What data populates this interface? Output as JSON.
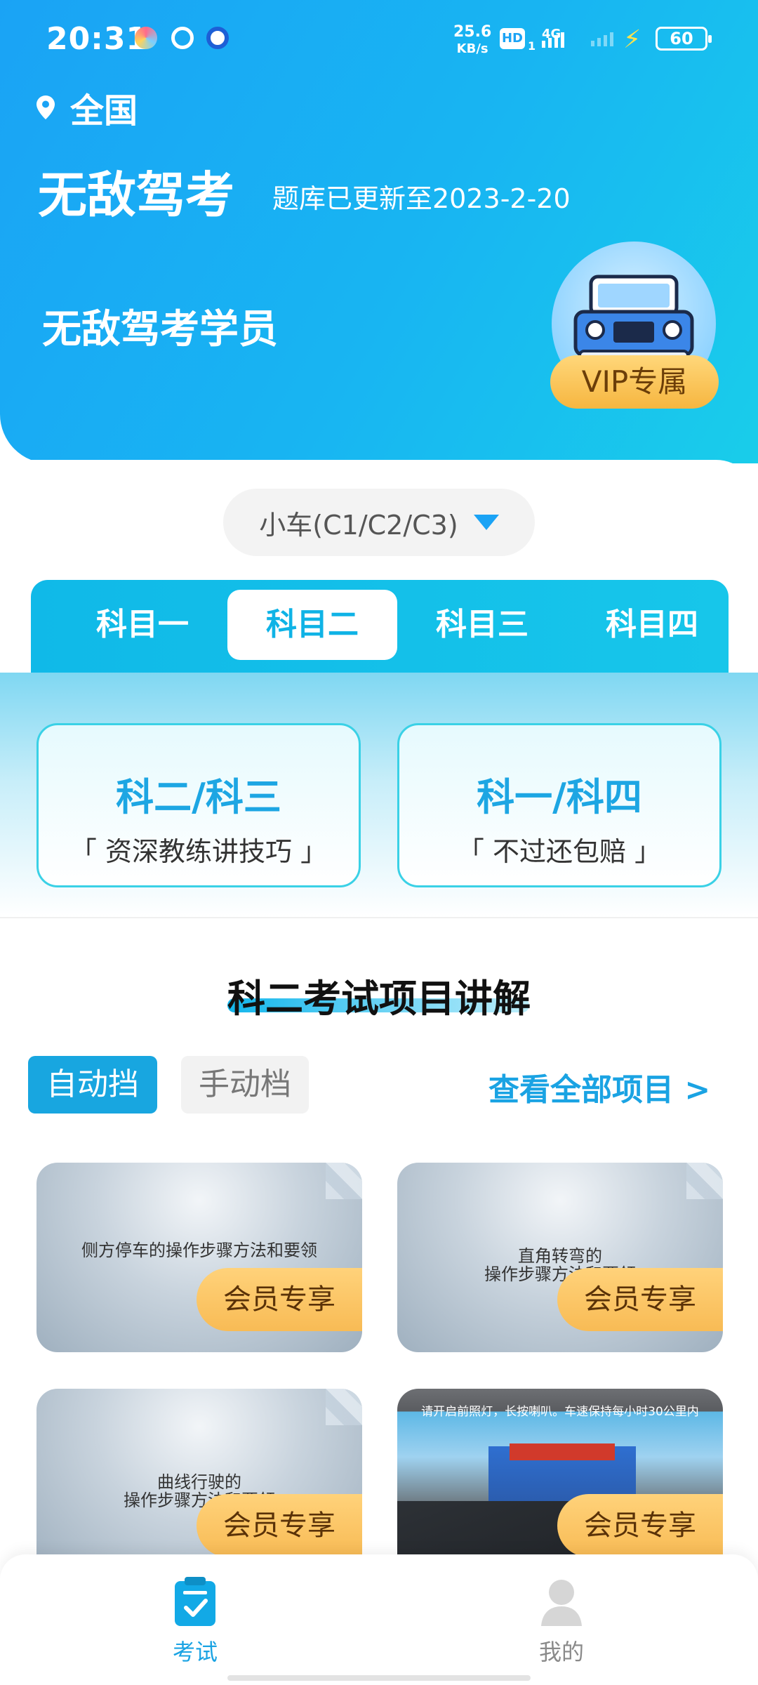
{
  "status_bar": {
    "time": "20:31",
    "net_speed_value": "25.6",
    "net_speed_unit": "KB/s",
    "hd": "HD",
    "hd_sub": "1",
    "network": "4G",
    "battery": "60",
    "icons": [
      "app-notification-icon",
      "app-notification-icon-2",
      "app-notification-icon-3",
      "signal-icon",
      "charging-icon",
      "battery-icon"
    ]
  },
  "header": {
    "location_icon": "location-pin-icon",
    "location": "全国",
    "brand": "无敌驾考",
    "update_text": "题库已更新至2023-2-20",
    "student": "无敌驾考学员",
    "vip_label": "VIP专属",
    "car_icon": "jeep-car-icon"
  },
  "vehicle_selector": {
    "label": "小车(C1/C2/C3)",
    "icon": "triangle-down-icon"
  },
  "subject_tabs": [
    {
      "label": "科目一",
      "active": false
    },
    {
      "label": "科目二",
      "active": true
    },
    {
      "label": "科目三",
      "active": false
    },
    {
      "label": "科目四",
      "active": false
    }
  ],
  "promos": [
    {
      "title": "科二/科三",
      "subtitle": "「 资深教练讲技巧 」"
    },
    {
      "title": "科一/科四",
      "subtitle": "「 不过还包赔 」"
    }
  ],
  "section": {
    "title": "科二考试项目讲解",
    "gear_auto": "自动挡",
    "gear_manual": "手动档",
    "view_all": "查看全部项目 >"
  },
  "cards": [
    {
      "line1": "侧方停车的操作步骤方法和要领",
      "line2": "",
      "badge": "会员专享"
    },
    {
      "line1": "直角转弯的",
      "line2": "操作步骤方法和要领",
      "badge": "会员专享"
    },
    {
      "line1": "曲线行驶的",
      "line2": "操作步骤方法和要领",
      "badge": "会员专享"
    },
    {
      "line1": "请开启前照灯，长按喇叭。车速保持每小时30公里内",
      "line2": "",
      "badge": "会员专享"
    }
  ],
  "bottom_nav": [
    {
      "label": "考试",
      "icon": "exam-check-icon",
      "active": true
    },
    {
      "label": "我的",
      "icon": "user-avatar-icon",
      "active": false
    }
  ],
  "colors": {
    "primary": "#1aa3f5",
    "tab_bg": "#12bfe9",
    "accent_gold": "#f8bb55",
    "nav_active": "#1aa3e3",
    "nav_inactive": "#8a8a8a"
  }
}
